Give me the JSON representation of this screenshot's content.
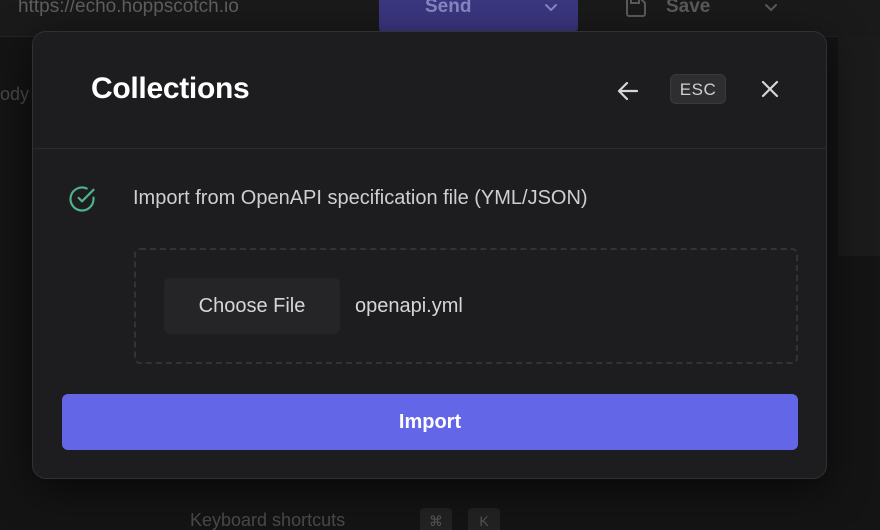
{
  "background": {
    "url_bar": {
      "value": "https://echo.hoppscotch.io"
    },
    "send_button": {
      "label": "Send",
      "color": "#6366e6"
    },
    "save_button": {
      "label": "Save"
    },
    "body_tab_label": "ody",
    "shortcuts": {
      "label": "Keyboard shortcuts",
      "keys": [
        "⌘",
        "K"
      ]
    }
  },
  "modal": {
    "title": "Collections",
    "esc_label": "ESC",
    "step": {
      "icon": "check-circle-icon",
      "label": "Import from OpenAPI specification file (YML/JSON)",
      "status_color": "#4fb38a"
    },
    "file_input": {
      "button_label": "Choose File",
      "file_name": "openapi.yml"
    },
    "import_button": {
      "label": "Import",
      "color": "#6366e6"
    }
  }
}
